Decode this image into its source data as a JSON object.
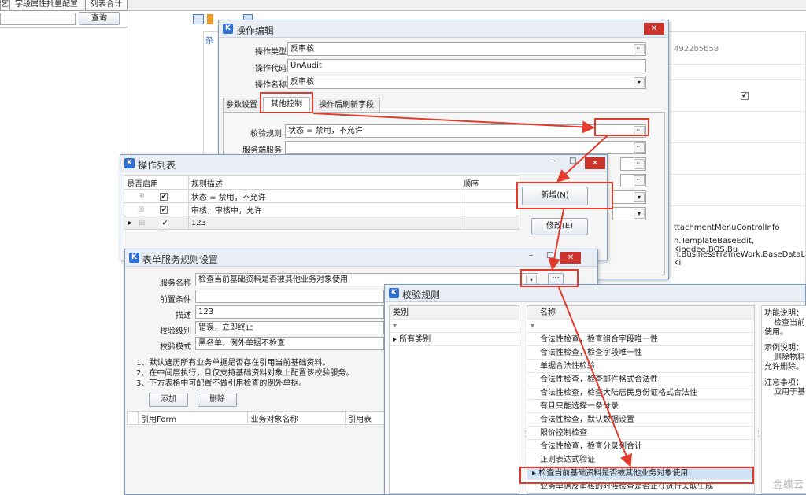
{
  "top_tabs": [
    "字段属性批量配置",
    "列表合计"
  ],
  "top_left": {
    "query_button": "查询",
    "stub": "乞"
  },
  "background": {
    "tab_stub": "杂",
    "id_text": "4922b5b58",
    "class_text_1": "ttachmentMenuControlInfo",
    "class_text_2": "n.TemplateBaseEdit, Kingdee.BOS.Bu",
    "class_text_3": "n.BusinessFrameWork.BaseDataList, Ki"
  },
  "op_edit": {
    "title": "操作编辑",
    "close": "✕",
    "fields": [
      {
        "label": "操作类型",
        "value": "反审核"
      },
      {
        "label": "操作代码",
        "value": "UnAudit"
      },
      {
        "label": "操作名称",
        "value": "反审核"
      }
    ],
    "tabs": [
      "参数设置",
      "其他控制",
      "操作后刷新字段"
    ],
    "rule_label": "校验规则",
    "rule_value": "状态 = 禁用，不允许",
    "service_label": "服务端服务"
  },
  "op_list": {
    "title": "操作列表",
    "close": "✕",
    "headers": [
      "是否启用",
      "规则描述",
      "顺序"
    ],
    "rows": [
      {
        "desc": "状态 = 禁用，不允许"
      },
      {
        "desc": "审核，审核中，允许"
      },
      {
        "desc": "123"
      }
    ],
    "add_button": "新增(N)",
    "edit_button": "修改(E)"
  },
  "svc_rule": {
    "title": "表单服务规则设置",
    "close": "✕",
    "fields": [
      {
        "label": "服务名称",
        "value": "检查当前基础资料是否被其他业务对象使用"
      },
      {
        "label": "前置条件",
        "value": ""
      },
      {
        "label": "描述",
        "value": "123"
      },
      {
        "label": "校验级别",
        "value": "错误，立即终止"
      },
      {
        "label": "校验模式",
        "value": "黑名单，例外单据不检查"
      }
    ],
    "notes": [
      "1、默认遍历所有业务单据是否存在引用当前基础资料。",
      "2、在中间层执行，且仅支持基础资料对象上配置该校验服务。",
      "3、下方表格中可配置不做引用检查的例外单据。"
    ],
    "add_button": "添加",
    "delete_button": "删除",
    "table_headers": [
      "引用Form",
      "业务对象名称",
      "引用表"
    ]
  },
  "validate": {
    "title": "校验规则",
    "col_category": "类别",
    "col_name": "名称",
    "category_items": [
      "所有类别"
    ],
    "items": [
      "合法性检查，检查组合字段唯一性",
      "合法性检查，检查字段唯一性",
      "单据合法性检验",
      "合法性检查，检查邮件格式合法性",
      "合法性检查，检查大陆居民身份证格式合法性",
      "有且只能选择一条分录",
      "合法性检查，默认数据设置",
      "限价控制检查",
      "合法性检查，检查分录列合计",
      "正则表达式验证",
      "检查当前基础资料是否被其他业务对象使用",
      "业务单据反审核的时候检查是否正在进行关联生成"
    ],
    "desc_title_1": "功能说明：",
    "desc_text_1": "检查当前",
    "desc_text_1b": "使用。",
    "desc_title_2": "示例说明：",
    "desc_text_2": "删除物料",
    "desc_text_2b": "允许删除。",
    "desc_title_3": "注意事项：",
    "desc_text_3": "应用于基"
  },
  "watermark": "金蝶云"
}
